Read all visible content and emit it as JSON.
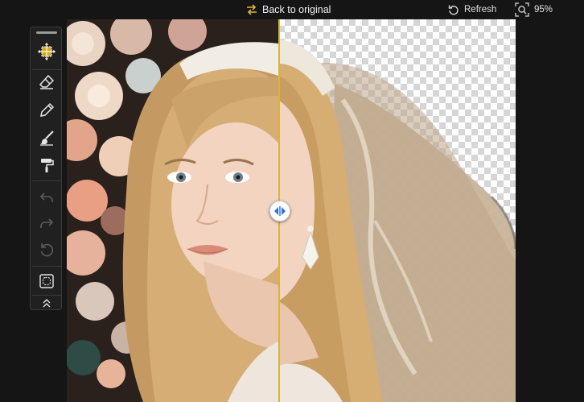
{
  "topbar": {
    "back_label": "Back to original",
    "refresh_label": "Refresh",
    "zoom_value": "95%"
  },
  "toolbar": {
    "tools": [
      "move-tool",
      "eraser-tool",
      "brush-tool",
      "restore-brush-tool",
      "fill-roller-tool",
      "undo",
      "redo",
      "reset",
      "select-area-tool",
      "collapse-toolbar"
    ]
  },
  "colors": {
    "background": "#151515",
    "accent": "#d9b43a",
    "toolbar_bg": "#202020"
  }
}
